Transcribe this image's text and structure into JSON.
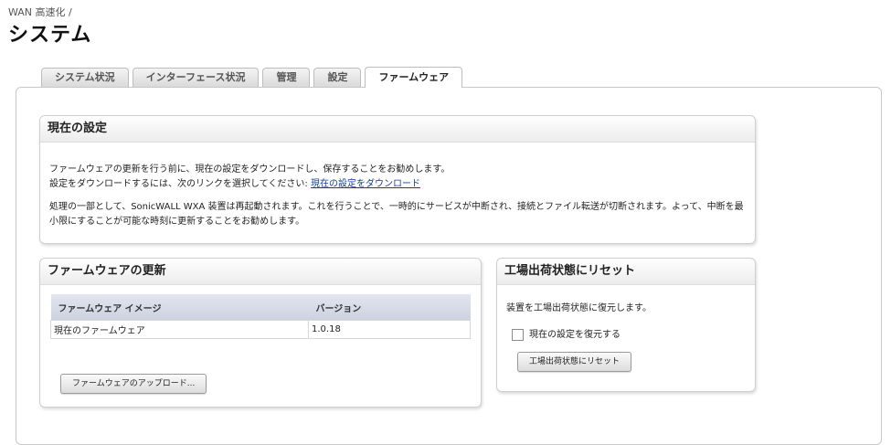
{
  "breadcrumb": "WAN 高速化 /",
  "page_title": "システム",
  "tabs": [
    {
      "label": "システム状況"
    },
    {
      "label": "インターフェース状況"
    },
    {
      "label": "管理"
    },
    {
      "label": "設定"
    },
    {
      "label": "ファームウェア",
      "active": true
    }
  ],
  "current_settings": {
    "title": "現在の設定",
    "line1": "ファームウェアの更新を行う前に、現在の設定をダウンロードし、保存することをお勧めします。",
    "line2_prefix": "設定をダウンロードするには、次のリンクを選択してください:",
    "download_link": "現在の設定をダウンロード",
    "line3": "処理の一部として、SonicWALL WXA 装置は再起動されます。これを行うことで、一時的にサービスが中断され、接続とファイル転送が切断されます。よって、中断を最",
    "line4": "小限にすることが可能な時刻に更新することをお勧めします。"
  },
  "firmware_update": {
    "title": "ファームウェアの更新",
    "table_headers": [
      "ファームウェア イメージ",
      "バージョン"
    ],
    "rows": [
      {
        "image": "現在のファームウェア",
        "version": "1.0.18"
      }
    ],
    "upload_button": "ファームウェアのアップロード..."
  },
  "factory_reset": {
    "title": "工場出荷状態にリセット",
    "description": "装置を工場出荷状態に復元します。",
    "checkbox_label": "現在の設定を復元する",
    "reset_button": "工場出荷状態にリセット"
  }
}
